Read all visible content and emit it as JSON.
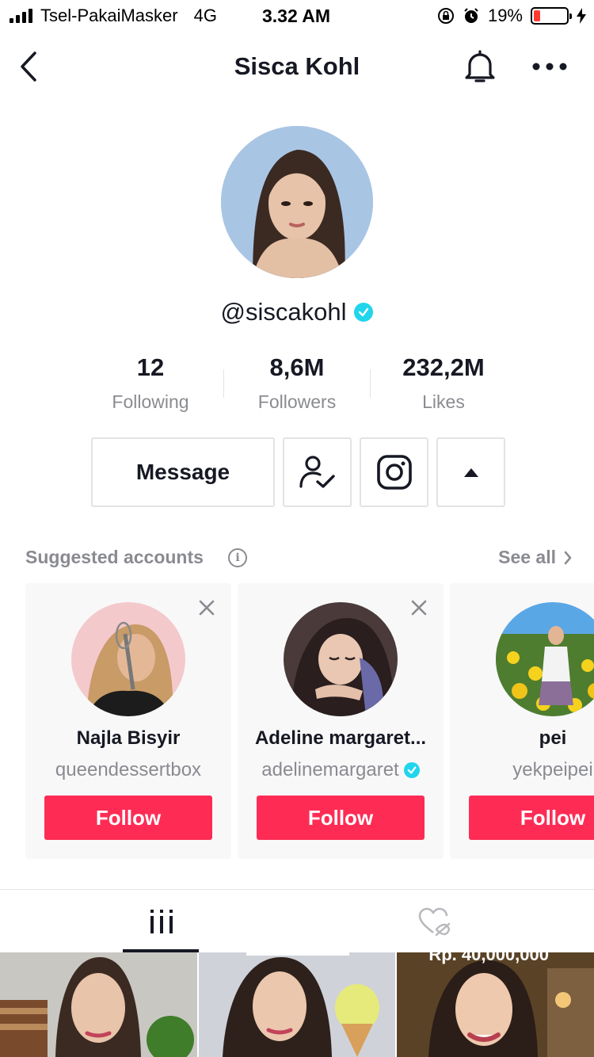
{
  "status_bar": {
    "carrier": "Tsel-PakaiMasker",
    "network": "4G",
    "time": "3.32 AM",
    "battery": "19%",
    "battery_level": 0.19
  },
  "header": {
    "title": "Sisca Kohl",
    "icons": [
      "back-chevron-icon",
      "bell-icon",
      "more-icon"
    ]
  },
  "profile": {
    "username": "@siscakohl",
    "verified": true,
    "stats": [
      {
        "value": "12",
        "label": "Following"
      },
      {
        "value": "8,6M",
        "label": "Followers"
      },
      {
        "value": "232,2M",
        "label": "Likes"
      }
    ],
    "message_label": "Message"
  },
  "suggested": {
    "title": "Suggested accounts",
    "see_all": "See all",
    "cards": [
      {
        "name": "Najla Bisyir",
        "handle": "queendessertbox",
        "verified": false,
        "follow_label": "Follow"
      },
      {
        "name": "Adeline margaret...",
        "handle": "adelinemargaret",
        "verified": true,
        "follow_label": "Follow"
      },
      {
        "name": "pei",
        "handle": "yekpeipei",
        "verified": false,
        "follow_label": "Follow"
      }
    ]
  },
  "tabs": [
    "videos-grid-icon",
    "liked-hidden-icon"
  ],
  "videos": [
    {
      "overlay_text": ""
    },
    {
      "overlay_text": ""
    },
    {
      "overlay_text": "Rp. 40,000,000"
    }
  ],
  "colors": {
    "accent": "#fe2c55",
    "verified": "#20d5ec",
    "muted": "#8a8b91",
    "text": "#161823"
  }
}
